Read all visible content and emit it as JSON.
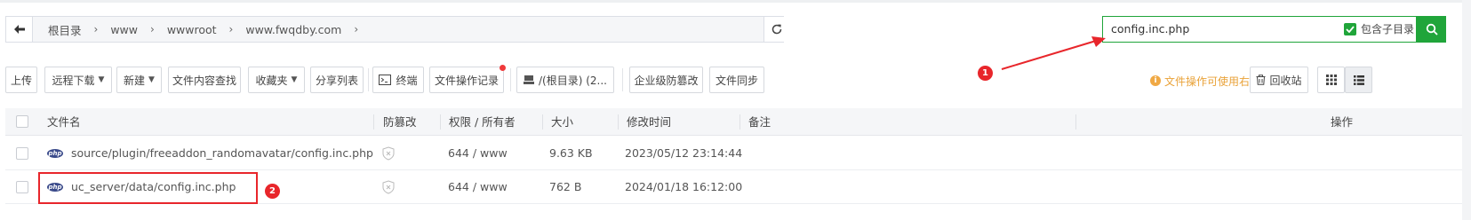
{
  "breadcrumb": [
    "根目录",
    "www",
    "wwwroot",
    "www.fwqdby.com"
  ],
  "search": {
    "value": "config.inc.php",
    "include_subdir_label": "包含子目录",
    "include_subdir_checked": true
  },
  "toolbar": {
    "upload": "上传",
    "remote_download": "远程下载",
    "new": "新建",
    "content_search": "文件内容查找",
    "favorites": "收藏夹",
    "share_list": "分享列表",
    "terminal": "终端",
    "operation_log": "文件操作记录",
    "disk": "/(根目录) (2...",
    "tamper": "企业级防篡改",
    "sync": "文件同步",
    "tip": "文件操作可使用右键",
    "recycle": "回收站"
  },
  "annotations": {
    "one": "1",
    "two": "2"
  },
  "table": {
    "headers": {
      "name": "文件名",
      "tamper": "防篡改",
      "perm": "权限 / 所有者",
      "size": "大小",
      "mtime": "修改时间",
      "note": "备注",
      "actions": "操作"
    },
    "rows": [
      {
        "name": "source/plugin/freeaddon_randomavatar/config.inc.php",
        "perm": "644 / www",
        "size": "9.63 KB",
        "mtime": "2023/05/12 23:14:44"
      },
      {
        "name": "uc_server/data/config.inc.php",
        "perm": "644 / www",
        "size": "762 B",
        "mtime": "2024/01/18 16:12:00"
      }
    ]
  },
  "colors": {
    "accent": "#20a53a",
    "annotation": "#e8262b",
    "tip": "#e9a238"
  }
}
